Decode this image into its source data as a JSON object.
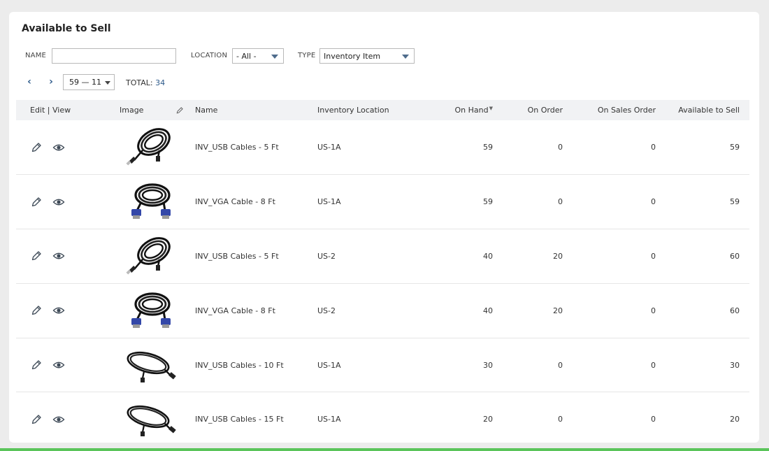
{
  "page": {
    "title": "Available to Sell"
  },
  "filters": {
    "name_label": "NAME",
    "name_value": "",
    "location_label": "LOCATION",
    "location_value": "- All -",
    "type_label": "TYPE",
    "type_value": "Inventory Item"
  },
  "pager": {
    "prev_icon": "chevron-left-icon",
    "next_icon": "chevron-right-icon",
    "range": "59 — 11",
    "total_label": "TOTAL:",
    "total_value": "34"
  },
  "table": {
    "headers": {
      "edit_view": "Edit | View",
      "image": "Image",
      "name": "Name",
      "location": "Inventory Location",
      "on_hand": "On Hand",
      "on_order": "On Order",
      "on_sales_order": "On Sales Order",
      "available": "Available to Sell"
    },
    "rows": [
      {
        "name": "INV_USB Cables - 5 Ft",
        "location": "US-1A",
        "on_hand": "59",
        "on_order": "0",
        "on_sales_order": "0",
        "available": "59",
        "image": "usb-cable-coil"
      },
      {
        "name": "INV_VGA Cable - 8 Ft",
        "location": "US-1A",
        "on_hand": "59",
        "on_order": "0",
        "on_sales_order": "0",
        "available": "59",
        "image": "vga-cable-coil"
      },
      {
        "name": "INV_USB Cables - 5 Ft",
        "location": "US-2",
        "on_hand": "40",
        "on_order": "20",
        "on_sales_order": "0",
        "available": "60",
        "image": "usb-cable-coil"
      },
      {
        "name": "INV_VGA Cable - 8 Ft",
        "location": "US-2",
        "on_hand": "40",
        "on_order": "20",
        "on_sales_order": "0",
        "available": "60",
        "image": "vga-cable-coil"
      },
      {
        "name": "INV_USB Cables - 10 Ft",
        "location": "US-1A",
        "on_hand": "30",
        "on_order": "0",
        "on_sales_order": "0",
        "available": "30",
        "image": "usb-cable-loop"
      },
      {
        "name": "INV_USB Cables - 15 Ft",
        "location": "US-1A",
        "on_hand": "20",
        "on_order": "0",
        "on_sales_order": "0",
        "available": "20",
        "image": "usb-cable-loop"
      }
    ]
  },
  "colors": {
    "accent": "#2d5a8a",
    "caret": "#4f6c8c",
    "header_bg": "#f1f2f4",
    "status_bar": "#5ac45a"
  }
}
